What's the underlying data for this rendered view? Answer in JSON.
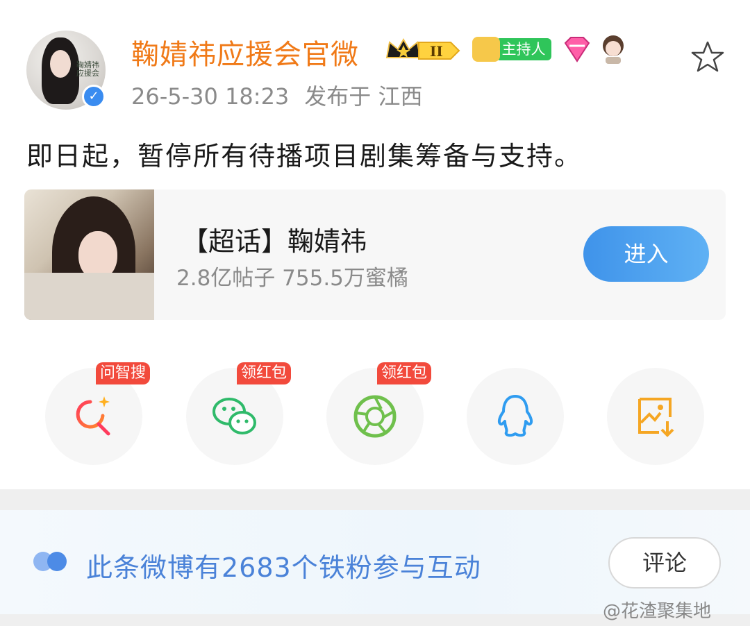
{
  "post": {
    "username": "鞠婧祎应援会官微",
    "avatar_text": "鞠婧祎\n应援会",
    "crown_badge_level": "II",
    "host_badge_label": "主持人",
    "time": "26-5-30 18:23",
    "location": "发布于 江西",
    "content": "即日起，暂停所有待播项目剧集筹备与支持。"
  },
  "topic": {
    "title": "【超话】鞠婧祎",
    "stats": "2.8亿帖子 755.5万蜜橘",
    "enter_label": "进入"
  },
  "share": {
    "items": [
      {
        "name": "ai-search",
        "badge": "问智搜"
      },
      {
        "name": "wechat",
        "badge": "领红包"
      },
      {
        "name": "moments",
        "badge": "领红包"
      },
      {
        "name": "qq",
        "badge": ""
      },
      {
        "name": "save-image",
        "badge": ""
      }
    ]
  },
  "fans": {
    "text": "此条微博有2683个铁粉参与互动",
    "comment_label": "评论"
  },
  "watermark": "@花渣聚集地",
  "colors": {
    "username": "#f07a18",
    "accent_blue": "#3f93ea",
    "badge_red": "#f24a3c",
    "host_green": "#2fc55a",
    "fan_text": "#4a82d8"
  }
}
